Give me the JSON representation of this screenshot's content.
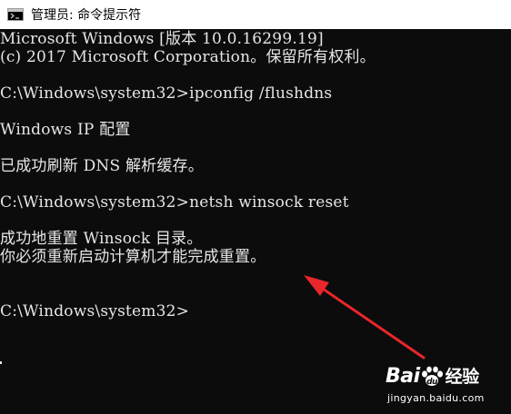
{
  "window": {
    "title": "管理员: 命令提示符",
    "icon": "cmd-icon"
  },
  "console": {
    "lines": [
      "Microsoft Windows [版本 10.0.16299.19]",
      "(c) 2017 Microsoft Corporation。保留所有权利。",
      "",
      "C:\\Windows\\system32>ipconfig /flushdns",
      "",
      "Windows IP 配置",
      "",
      "已成功刷新 DNS 解析缓存。",
      "",
      "C:\\Windows\\system32>netsh winsock reset",
      "",
      "成功地重置 Winsock 目录。",
      "你必须重新启动计算机才能完成重置。",
      "",
      "",
      "C:\\Windows\\system32>"
    ]
  },
  "annotation": {
    "arrow_color": "#e8262b",
    "icon": "red-arrow-icon"
  },
  "watermark": {
    "logo_text": "Bai",
    "logo_suffix": "经验",
    "url": "jingyan.baidu.com"
  }
}
